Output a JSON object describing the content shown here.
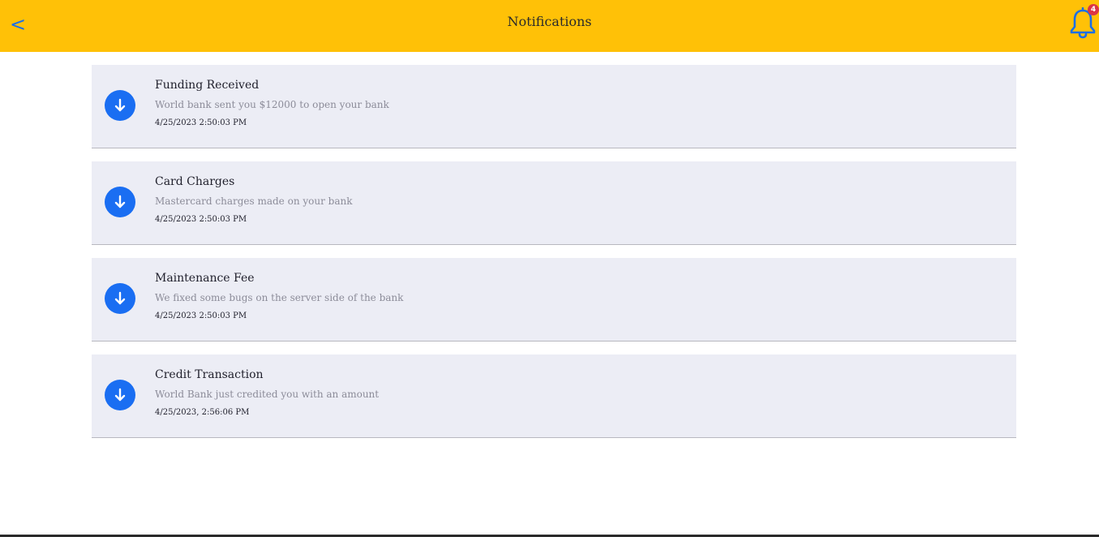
{
  "header": {
    "back_label": "<",
    "title": "Notifications",
    "bell_icon": "bell-icon",
    "badge_count": "4",
    "accent_color": "#ffc107"
  },
  "notifications": [
    {
      "icon": "arrow-down-icon",
      "title": "Funding Received",
      "description": "World bank sent you $12000 to open your bank",
      "timestamp": "4/25/2023 2:50:03 PM"
    },
    {
      "icon": "arrow-down-icon",
      "title": "Card Charges",
      "description": "Mastercard charges made on your bank",
      "timestamp": "4/25/2023 2:50:03 PM"
    },
    {
      "icon": "arrow-down-icon",
      "title": "Maintenance Fee",
      "description": "We fixed some bugs on the server side of the bank",
      "timestamp": "4/25/2023 2:50:03 PM"
    },
    {
      "icon": "arrow-down-icon",
      "title": "Credit Transaction",
      "description": "World Bank just credited you with an amount",
      "timestamp": "4/25/2023, 2:56:06 PM"
    }
  ],
  "colors": {
    "icon_bg": "#1a6ef2",
    "card_bg": "#ecedf5",
    "badge": "#dc3545"
  }
}
